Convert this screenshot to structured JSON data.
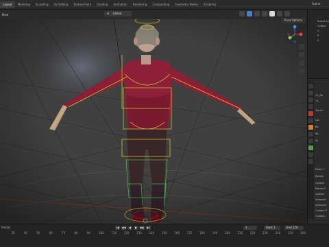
{
  "workspace_tabs": [
    "Layout",
    "Modeling",
    "Sculpting",
    "UV Editing",
    "Texture Paint",
    "Shading",
    "Animation",
    "Rendering",
    "Compositing",
    "Geometry Nodes",
    "Scripting"
  ],
  "active_tab": "Layout",
  "scene_name": "Scene",
  "viewport": {
    "mode": "Pose",
    "transform_orientation": "Global",
    "pose_options": "Pose Options"
  },
  "outliner": {
    "items": [
      "Scene Col",
      "Collect",
      "C",
      "R",
      "2"
    ]
  },
  "properties": {
    "rows": [
      "11_Ro",
      "11_",
      "Transf",
      "Loc",
      "Ro",
      "Ro",
      "Sc",
      "Delta T",
      "Relatio",
      "Collecti",
      "Motion F",
      "Visibilit",
      "Viewport",
      "Instancin",
      "Custom P",
      "Custom"
    ]
  },
  "timeline": {
    "marker": "Marker",
    "ticks": [
      "30",
      "40",
      "50",
      "60",
      "70",
      "80",
      "90",
      "100",
      "110",
      "120",
      "130",
      "140",
      "150",
      "160",
      "170",
      "180",
      "190",
      "200",
      "210",
      "220",
      "230",
      "240",
      "250",
      "260"
    ],
    "current_frame": "1",
    "start_label": "Start",
    "start": "1",
    "end_label": "End",
    "end": "250"
  },
  "colors": {
    "accent": "#4a7fc1",
    "shirt": "#8a1f35",
    "pants": "#3a2628",
    "bone_yellow": "#d8c030",
    "bone_green": "#3fbf3f"
  }
}
